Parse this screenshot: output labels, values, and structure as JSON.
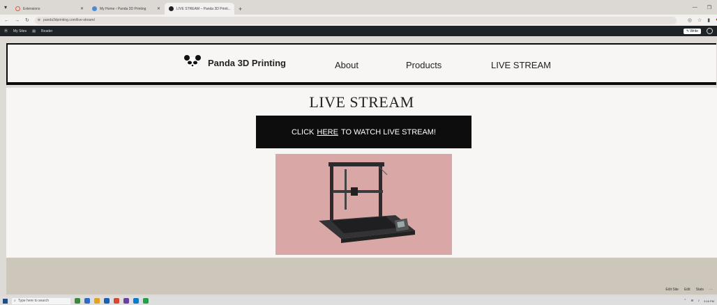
{
  "browser": {
    "tabs": [
      {
        "label": "Extensions",
        "active": false,
        "fav_color": "#e05a3a"
      },
      {
        "label": "My Home ‹ Panda 3D Printing",
        "active": false,
        "fav_color": "#4a8ad6"
      },
      {
        "label": "LIVE STREAM – Panda 3D Printi...",
        "active": true,
        "fav_color": "#222222"
      }
    ],
    "new_tab": "+",
    "url": "panda3dprinting.com/live-stream/",
    "write_label": "Write"
  },
  "wp_admin": {
    "my_sites": "My Sites",
    "reader": "Reader"
  },
  "site": {
    "brand": "Panda 3D Printing",
    "nav": [
      "About",
      "Products",
      "LIVE STREAM"
    ]
  },
  "page": {
    "title": "LIVE STREAM",
    "cta_prefix": "CLICK",
    "cta_link": "HERE",
    "cta_suffix": "TO WATCH LIVE STREAM!"
  },
  "footer": {
    "links": [
      "Edit Site",
      "Edit",
      "Stats"
    ]
  },
  "taskbar": {
    "search_placeholder": "Type here to search",
    "time": "3:16 PM"
  },
  "colors": {
    "header_border": "#0a0a0a",
    "cta_bg": "#0d0d0d",
    "hero_bg": "#d9a8a6",
    "footer_bg": "#cdc6bb"
  }
}
